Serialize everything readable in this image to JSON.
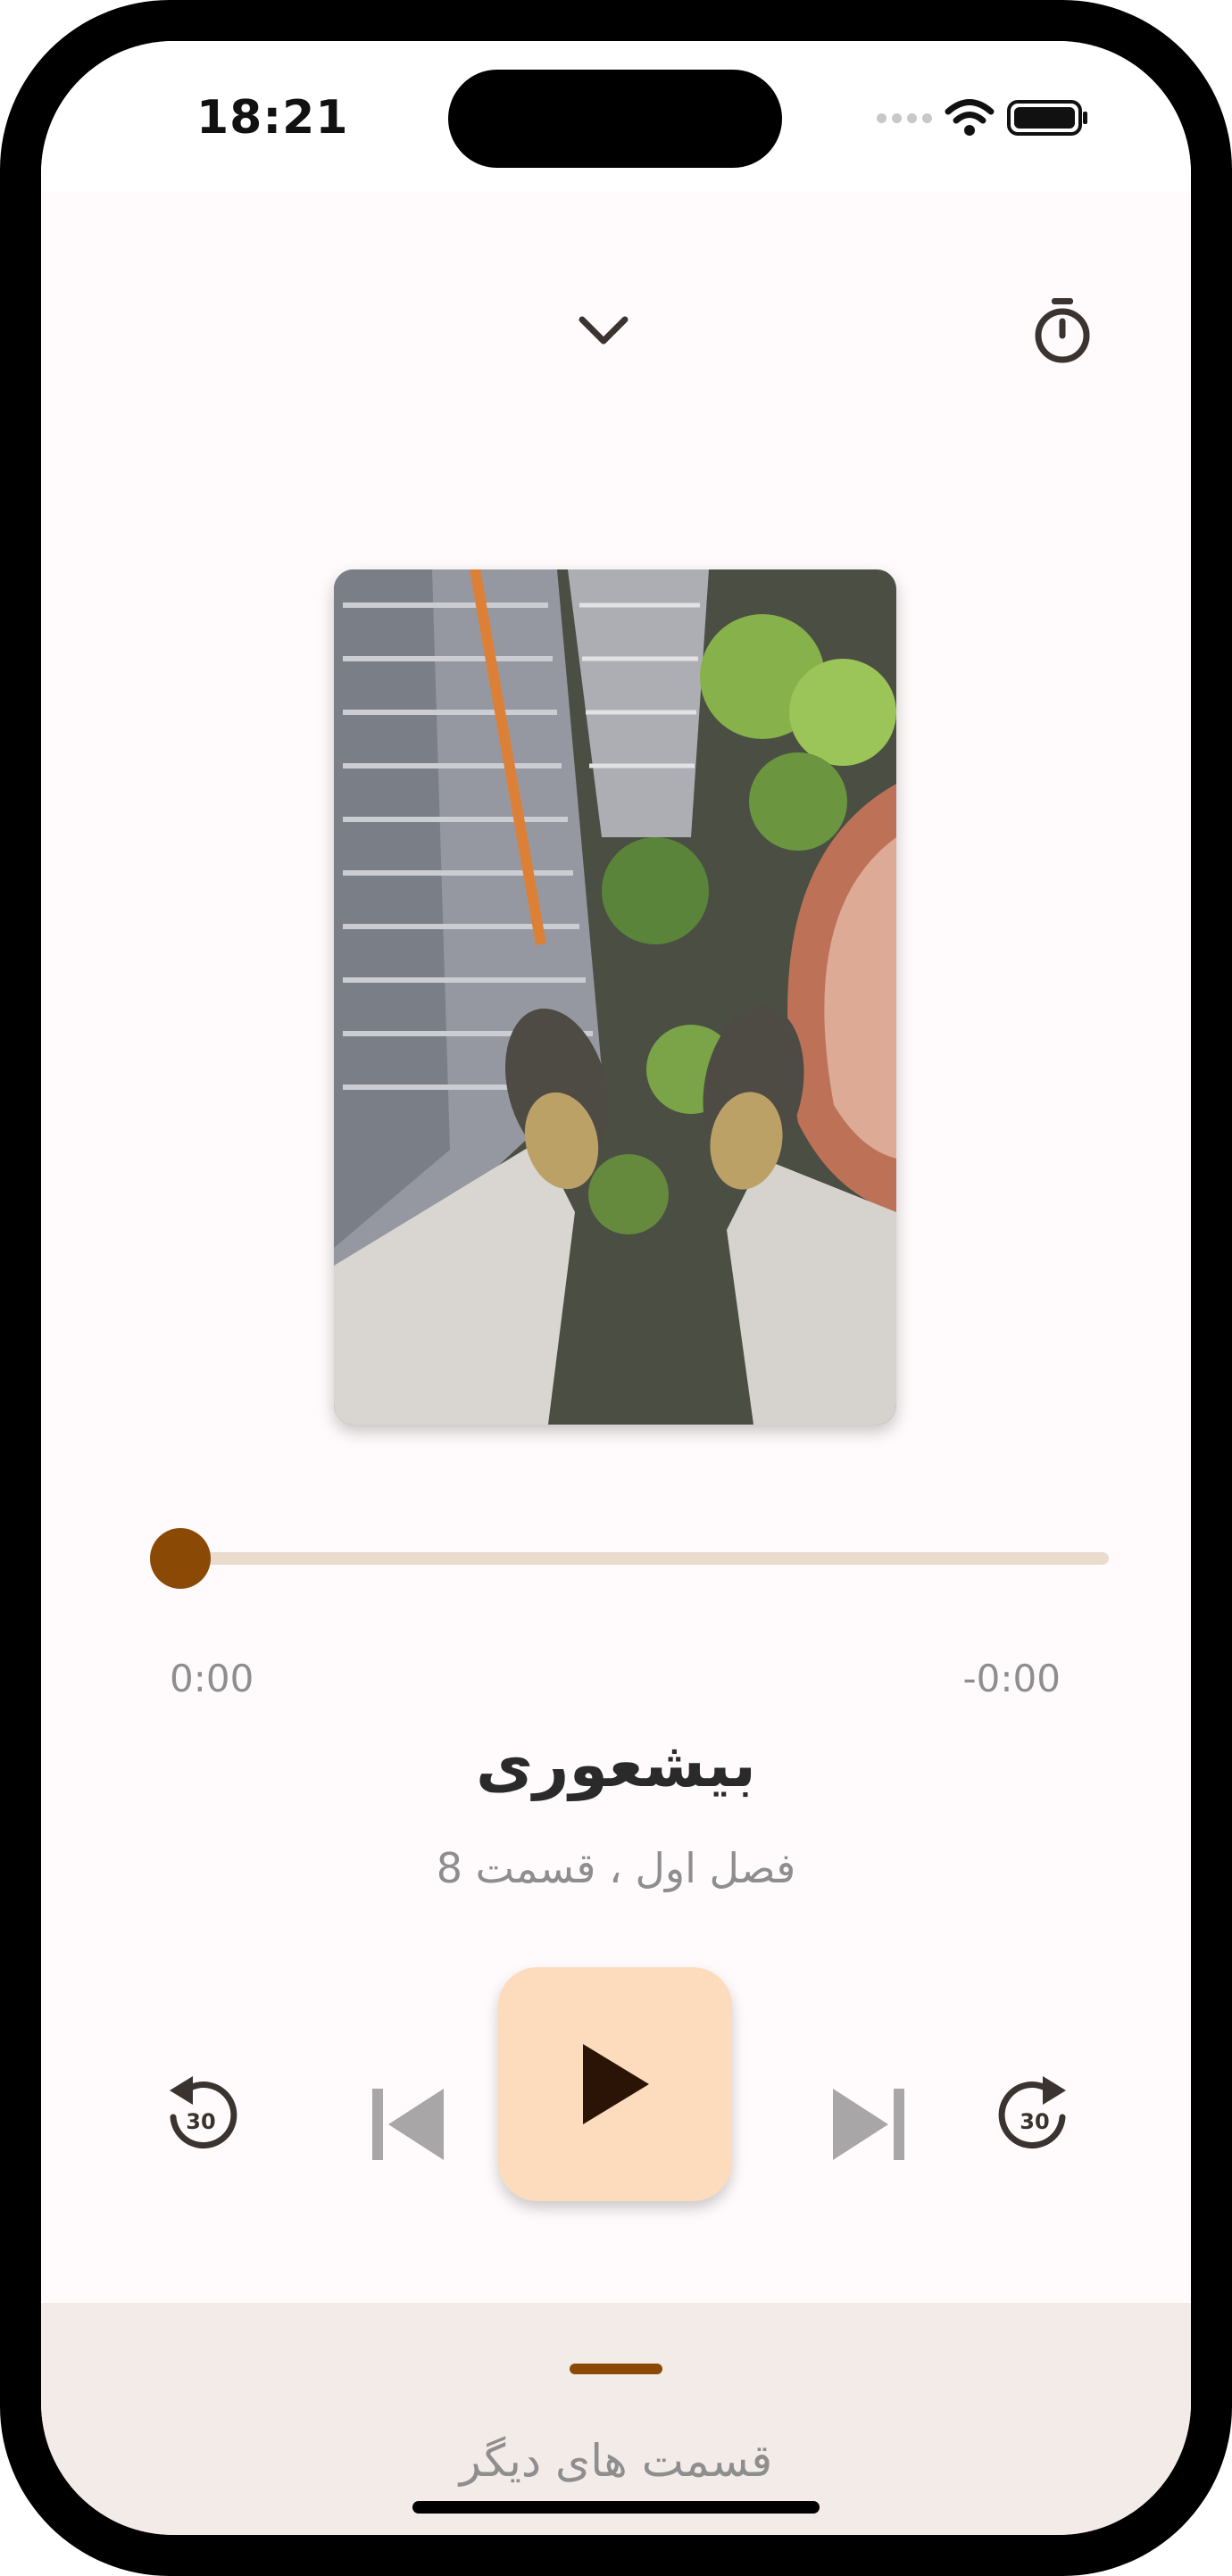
{
  "status_bar": {
    "time": "18:21",
    "icons": [
      "cellular-signal-icon",
      "wifi-icon",
      "battery-icon"
    ]
  },
  "header": {
    "collapse_icon": "chevron-down-icon",
    "timer_icon": "stopwatch-icon"
  },
  "cover": {
    "alt": "Cover art: legs dangling over a city street seen from a skyscraper"
  },
  "progress": {
    "elapsed": "0:00",
    "remaining": "-0:00",
    "fraction": 0
  },
  "track": {
    "title": "بیشعوری",
    "subtitle": "فصل اول ، قسمت 8"
  },
  "controls": {
    "rewind_icon": "rewind-30-icon",
    "rewind_seconds": "30",
    "previous_icon": "skip-previous-icon",
    "play_icon": "play-icon",
    "next_icon": "skip-next-icon",
    "forward_icon": "forward-30-icon",
    "forward_seconds": "30"
  },
  "bottom_sheet": {
    "label": "قسمت های دیگر"
  },
  "colors": {
    "accent": "#8a4a05",
    "track": "#eadbcd",
    "play_bg": "#fddcbd",
    "play_icon": "#2b1405",
    "disabled_icon": "#a8a6a6",
    "sheet_bg": "#f3ebe8",
    "background": "#fffbfc"
  }
}
